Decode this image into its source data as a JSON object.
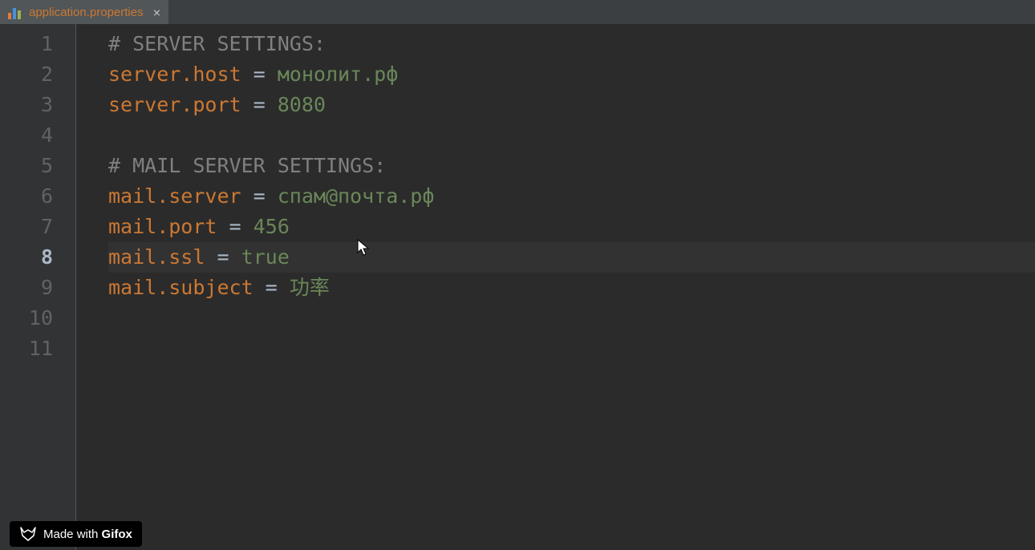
{
  "tab": {
    "filename": "application.properties",
    "close_glyph": "×"
  },
  "gutter": {
    "numbers": [
      "1",
      "2",
      "3",
      "4",
      "5",
      "6",
      "7",
      "8",
      "9",
      "10",
      "11"
    ],
    "current": 8
  },
  "lines": {
    "l1": {
      "comment": "# SERVER SETTINGS:"
    },
    "l2": {
      "key": "server.host",
      "equals": " = ",
      "value": "монолит.рф"
    },
    "l3": {
      "key": "server.port",
      "equals": " = ",
      "value": "8080"
    },
    "l4": {
      "blank": ""
    },
    "l5": {
      "comment": "# MAIL SERVER SETTINGS:"
    },
    "l6": {
      "key": "mail.server",
      "equals": " = ",
      "value": "спам@почта.рф"
    },
    "l7": {
      "key": "mail.port",
      "equals": " = ",
      "value": "456"
    },
    "l8": {
      "key": "mail.ssl",
      "equals": " = ",
      "value": "true"
    },
    "l9": {
      "key": "mail.subject",
      "equals": " = ",
      "value": "功率"
    },
    "l10": {
      "blank": ""
    },
    "l11": {
      "blank": ""
    }
  },
  "badge": {
    "prefix": "Made with ",
    "brand": "Gifox"
  }
}
